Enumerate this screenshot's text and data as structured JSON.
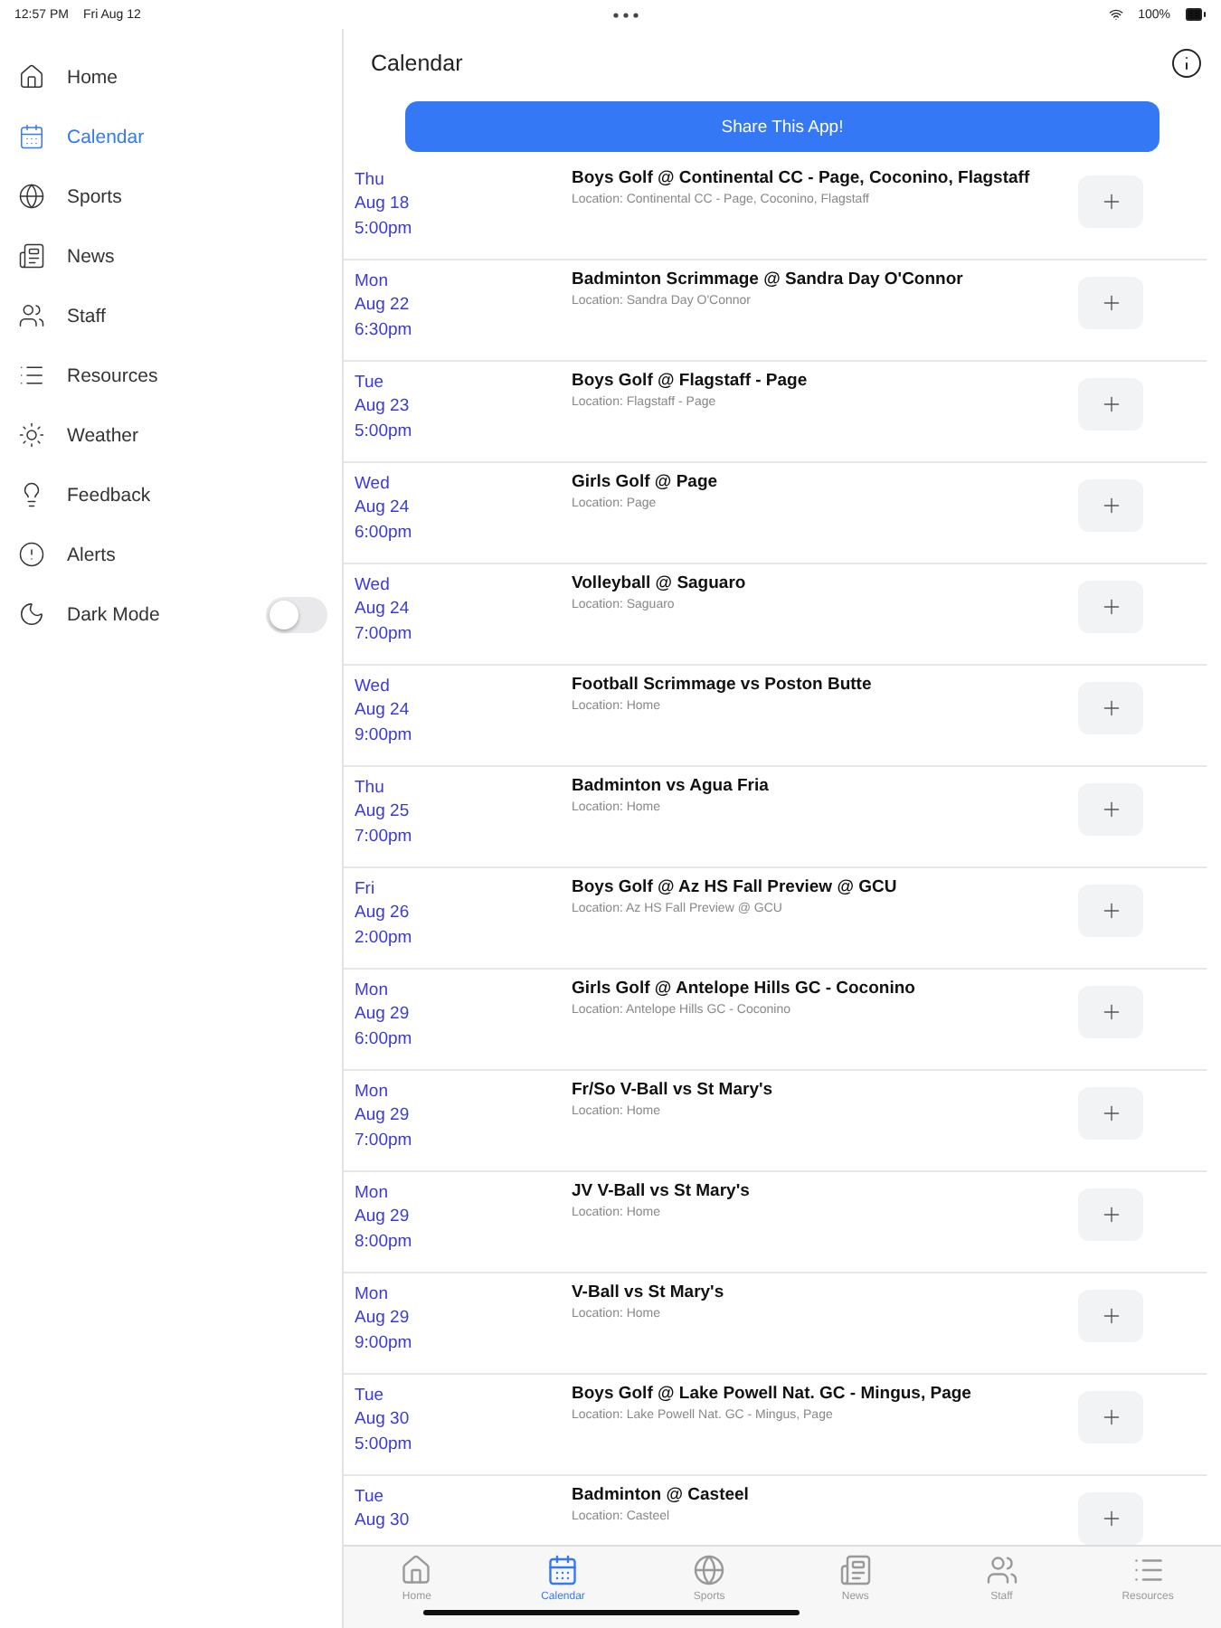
{
  "status_bar": {
    "time": "12:57 PM",
    "date": "Fri Aug 12",
    "battery": "100%"
  },
  "sidebar": {
    "items": [
      {
        "label": "Home",
        "selected": false
      },
      {
        "label": "Calendar",
        "selected": true
      },
      {
        "label": "Sports",
        "selected": false
      },
      {
        "label": "News",
        "selected": false
      },
      {
        "label": "Staff",
        "selected": false
      },
      {
        "label": "Resources",
        "selected": false
      },
      {
        "label": "Weather",
        "selected": false
      },
      {
        "label": "Feedback",
        "selected": false
      },
      {
        "label": "Alerts",
        "selected": false
      }
    ],
    "dark_mode": {
      "label": "Dark Mode",
      "on": false
    }
  },
  "header": {
    "title": "Calendar"
  },
  "share_button": "Share This App!",
  "events": [
    {
      "day": "Thu",
      "date": "Aug 18",
      "time": "5:00pm",
      "title": "Boys Golf @ Continental CC - Page, Coconino, Flagstaff",
      "location": "Location: Continental CC - Page, Coconino, Flagstaff"
    },
    {
      "day": "Mon",
      "date": "Aug 22",
      "time": "6:30pm",
      "title": "Badminton Scrimmage @ Sandra Day O'Connor",
      "location": "Location: Sandra Day O'Connor"
    },
    {
      "day": "Tue",
      "date": "Aug 23",
      "time": "5:00pm",
      "title": "Boys Golf @ Flagstaff - Page",
      "location": "Location: Flagstaff - Page"
    },
    {
      "day": "Wed",
      "date": "Aug 24",
      "time": "6:00pm",
      "title": "Girls Golf @ Page",
      "location": "Location: Page"
    },
    {
      "day": "Wed",
      "date": "Aug 24",
      "time": "7:00pm",
      "title": "Volleyball @ Saguaro",
      "location": "Location: Saguaro"
    },
    {
      "day": "Wed",
      "date": "Aug 24",
      "time": "9:00pm",
      "title": "Football Scrimmage vs Poston Butte",
      "location": "Location: Home"
    },
    {
      "day": "Thu",
      "date": "Aug 25",
      "time": "7:00pm",
      "title": "Badminton vs Agua Fria",
      "location": "Location: Home"
    },
    {
      "day": "Fri",
      "date": "Aug 26",
      "time": "2:00pm",
      "title": "Boys Golf @ Az HS Fall Preview @ GCU",
      "location": "Location: Az HS Fall Preview @ GCU"
    },
    {
      "day": "Mon",
      "date": "Aug 29",
      "time": "6:00pm",
      "title": "Girls Golf @ Antelope Hills GC - Coconino",
      "location": "Location: Antelope Hills GC - Coconino"
    },
    {
      "day": "Mon",
      "date": "Aug 29",
      "time": "7:00pm",
      "title": "Fr/So V-Ball vs St Mary's",
      "location": "Location: Home"
    },
    {
      "day": "Mon",
      "date": "Aug 29",
      "time": "8:00pm",
      "title": "JV V-Ball vs St Mary's",
      "location": "Location: Home"
    },
    {
      "day": "Mon",
      "date": "Aug 29",
      "time": "9:00pm",
      "title": "V-Ball vs St Mary's",
      "location": "Location: Home"
    },
    {
      "day": "Tue",
      "date": "Aug 30",
      "time": "5:00pm",
      "title": "Boys Golf @ Lake Powell Nat. GC - Mingus, Page",
      "location": "Location: Lake Powell Nat. GC - Mingus, Page"
    },
    {
      "day": "Tue",
      "date": "Aug 30",
      "title": "Badminton @ Casteel",
      "location": "Location: Casteel"
    }
  ],
  "tab_bar": [
    {
      "label": "Home",
      "selected": false
    },
    {
      "label": "Calendar",
      "selected": true
    },
    {
      "label": "Sports",
      "selected": false
    },
    {
      "label": "News",
      "selected": false
    },
    {
      "label": "Staff",
      "selected": false
    },
    {
      "label": "Resources",
      "selected": false
    }
  ]
}
